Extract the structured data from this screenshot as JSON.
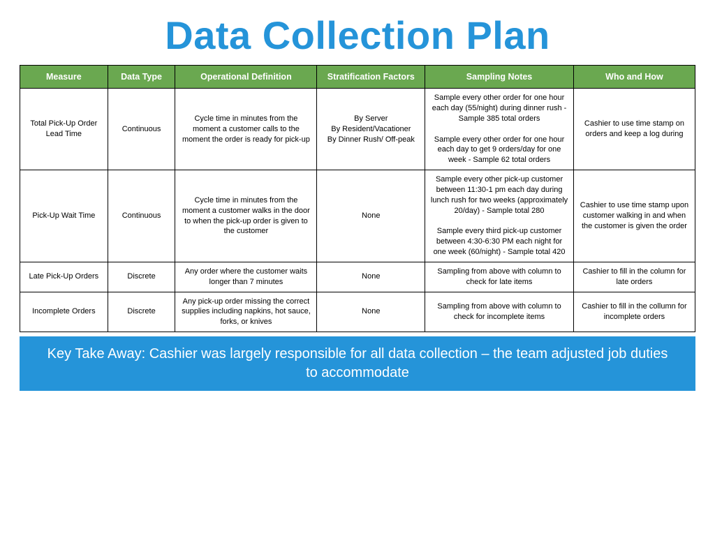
{
  "title": "Data Collection Plan",
  "headers": {
    "measure": "Measure",
    "data_type": "Data Type",
    "op_def": "Operational Definition",
    "strat": "Stratification Factors",
    "sampling": "Sampling Notes",
    "who": "Who and How"
  },
  "rows": [
    {
      "measure": "Total Pick-Up Order Lead Time",
      "data_type": "Continuous",
      "op_def": "Cycle time in minutes from the moment a customer calls to the moment the order is ready for pick-up",
      "strat": "By Server\nBy Resident/Vacationer\nBy Dinner Rush/ Off-peak",
      "sampling": "Sample every other order for one hour each day (55/night) during dinner rush - Sample 385 total orders\n\nSample every other order for one hour each day to get 9 orders/day for one week - Sample 62 total orders",
      "who": "Cashier to use time stamp on orders and keep a log during"
    },
    {
      "measure": "Pick-Up Wait Time",
      "data_type": "Continuous",
      "op_def": "Cycle time in minutes from the moment a customer walks in the door to when the pick-up order is given to the customer",
      "strat": "None",
      "sampling": "Sample every other pick-up customer between 11:30-1 pm each day during lunch rush for two weeks (approximately 20/day) - Sample total 280\n\nSample every third pick-up customer between 4:30-6:30 PM each night for one week (60/night) - Sample total 420",
      "who": "Cashier to use time stamp upon customer walking in and when the customer is given the order"
    },
    {
      "measure": "Late Pick-Up Orders",
      "data_type": "Discrete",
      "op_def": "Any order where the customer waits longer than 7 minutes",
      "strat": "None",
      "sampling": "Sampling from above with column to check for late items",
      "who": "Cashier to fill in the column for late orders"
    },
    {
      "measure": "Incomplete Orders",
      "data_type": "Discrete",
      "op_def": "Any pick-up order missing the correct supplies including napkins, hot sauce, forks, or knives",
      "strat": "None",
      "sampling": "Sampling from above with column to check for incomplete items",
      "who": "Cashier to fill in the collumn for incomplete orders"
    }
  ],
  "callout": "Key Take Away: Cashier was largely responsible for all data collection – the team adjusted job duties to accommodate"
}
